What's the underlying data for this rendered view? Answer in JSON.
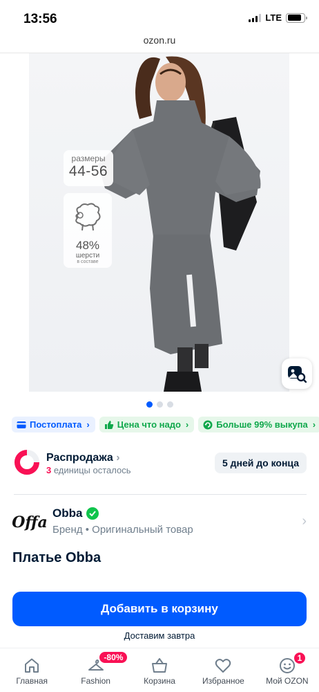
{
  "status_bar": {
    "time": "13:56",
    "network": "LTE",
    "battery_level": 0.85
  },
  "browser": {
    "url": "ozon.ru"
  },
  "product_image": {
    "size_card": {
      "label": "размеры",
      "value": "44-56"
    },
    "wool_card": {
      "icon": "sheep-icon",
      "percent": "48%",
      "line1": "шерсти",
      "line2": "в составе"
    },
    "zoom_icon": "image-search-icon",
    "dots_total": 3,
    "dots_active_index": 0
  },
  "chips": [
    {
      "label": "Постоплата",
      "icon": "card-icon",
      "color": "#005bff"
    },
    {
      "label": "Цена что надо",
      "icon": "thumb-up-icon",
      "color": "#10a84c"
    },
    {
      "label": "Больше 99% выкупа",
      "icon": "refresh-icon",
      "color": "#10a84c"
    }
  ],
  "sale": {
    "title": "Распродажа",
    "count": "3",
    "remaining_text": "единицы осталось",
    "badge": "5 дней до конца"
  },
  "brand": {
    "logo_text": "Offa",
    "name": "Obba",
    "subtitle": "Бренд • Оригинальный товар"
  },
  "product": {
    "title": "Платье Obba"
  },
  "actions": {
    "add_to_cart": "Добавить в корзину",
    "delivery": "Доставим завтра"
  },
  "bottom_nav": [
    {
      "label": "Главная",
      "icon": "home-icon"
    },
    {
      "label": "Fashion",
      "icon": "hanger-icon",
      "badge": "-80%"
    },
    {
      "label": "Корзина",
      "icon": "basket-icon"
    },
    {
      "label": "Избранное",
      "icon": "heart-icon"
    },
    {
      "label": "Мой OZON",
      "icon": "profile-icon",
      "badge": "1"
    }
  ],
  "colors": {
    "accent": "#005bff",
    "green": "#10a84c",
    "sale_red": "#f91155"
  }
}
